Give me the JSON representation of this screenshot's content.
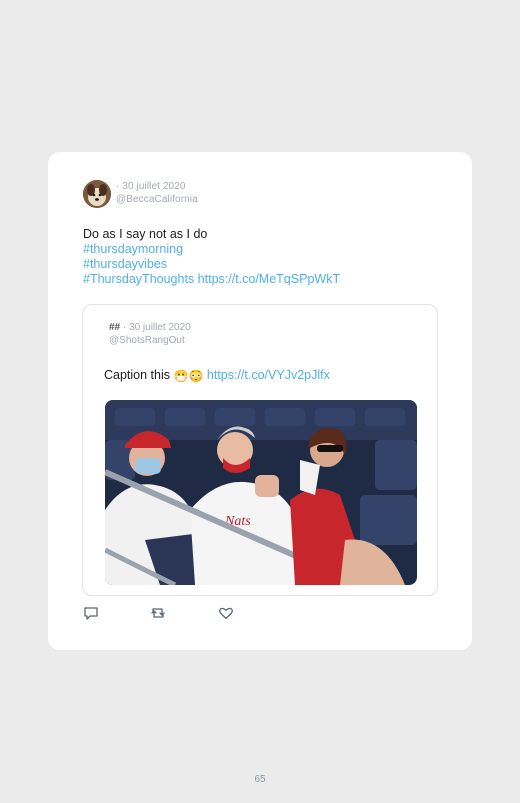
{
  "tweet": {
    "date": "· 30 juillet 2020",
    "handle": "@BeccaCalifornia",
    "text_line1": "Do as I say not as I do",
    "hashtag1": "#thursdaymorning",
    "hashtag2": "#thursdayvibes",
    "hashtag3": "#ThursdayThoughts",
    "link": "https://t.co/MeTqSPpWkT"
  },
  "quoted": {
    "name": "##",
    "date": "· 30 juillet 2020",
    "handle": "@ShotsRangOut",
    "caption": "Caption this",
    "emoji1": "😷",
    "emoji2": "😳",
    "link": "https://t.co/VYJv2pJlfx",
    "image_icon": "photo-of-three-spectators-in-stadium-seats"
  },
  "actions": {
    "reply_icon": "reply-icon",
    "retweet_icon": "retweet-icon",
    "like_icon": "heart-icon"
  },
  "page_number": "65",
  "colors": {
    "background": "#ebebeb",
    "card": "#ffffff",
    "link": "#4fb0e8",
    "meta": "#a3a8b0",
    "icon": "#5b6573"
  }
}
